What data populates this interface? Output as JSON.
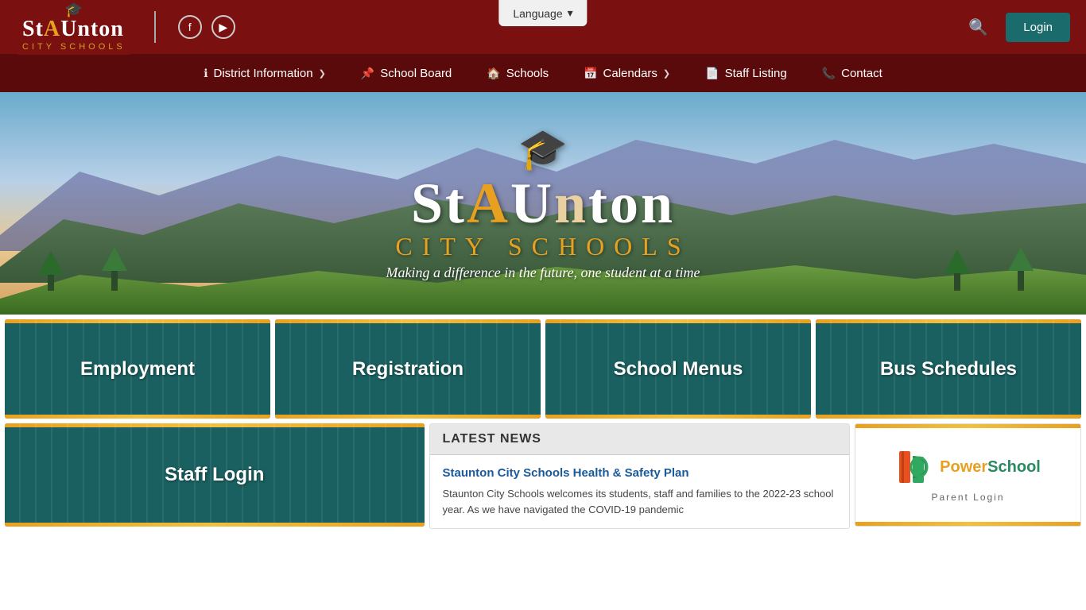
{
  "header": {
    "logo_main": "StAUnton",
    "logo_sub": "CITY SCHOOLS",
    "language_label": "Language",
    "login_label": "Login"
  },
  "nav": {
    "items": [
      {
        "label": "District Information",
        "icon": "ℹ",
        "has_chevron": true
      },
      {
        "label": "School Board",
        "icon": "📌",
        "has_chevron": false
      },
      {
        "label": "Schools",
        "icon": "🏠",
        "has_chevron": false
      },
      {
        "label": "Calendars",
        "icon": "📅",
        "has_chevron": true
      },
      {
        "label": "Staff Listing",
        "icon": "📄",
        "has_chevron": false
      },
      {
        "label": "Contact",
        "icon": "📞",
        "has_chevron": false
      }
    ]
  },
  "hero": {
    "title_part1": "St",
    "title_a": "A",
    "title_part2": "U",
    "title_part3": "nton",
    "city_schools": "CITY SCHOOLS",
    "tagline": "Making a difference in the future, one student at a time"
  },
  "quick_links": [
    {
      "label": "Employment"
    },
    {
      "label": "Registration"
    },
    {
      "label": "School Menus"
    },
    {
      "label": "Bus Schedules"
    }
  ],
  "staff_login": {
    "label": "Staff Login"
  },
  "news": {
    "section_title": "LATEST NEWS",
    "article_title": "Staunton City Schools Health & Safety Plan",
    "article_text": "Staunton City Schools welcomes its students, staff and families to the 2022-23 school year.  As we have navigated the COVID-19 pandemic"
  },
  "powerschool": {
    "title": "PowerSchool",
    "subtitle": "Parent Login",
    "title_p1": "Power",
    "title_p2": "School"
  },
  "social": {
    "facebook": "f",
    "youtube": "▶"
  }
}
